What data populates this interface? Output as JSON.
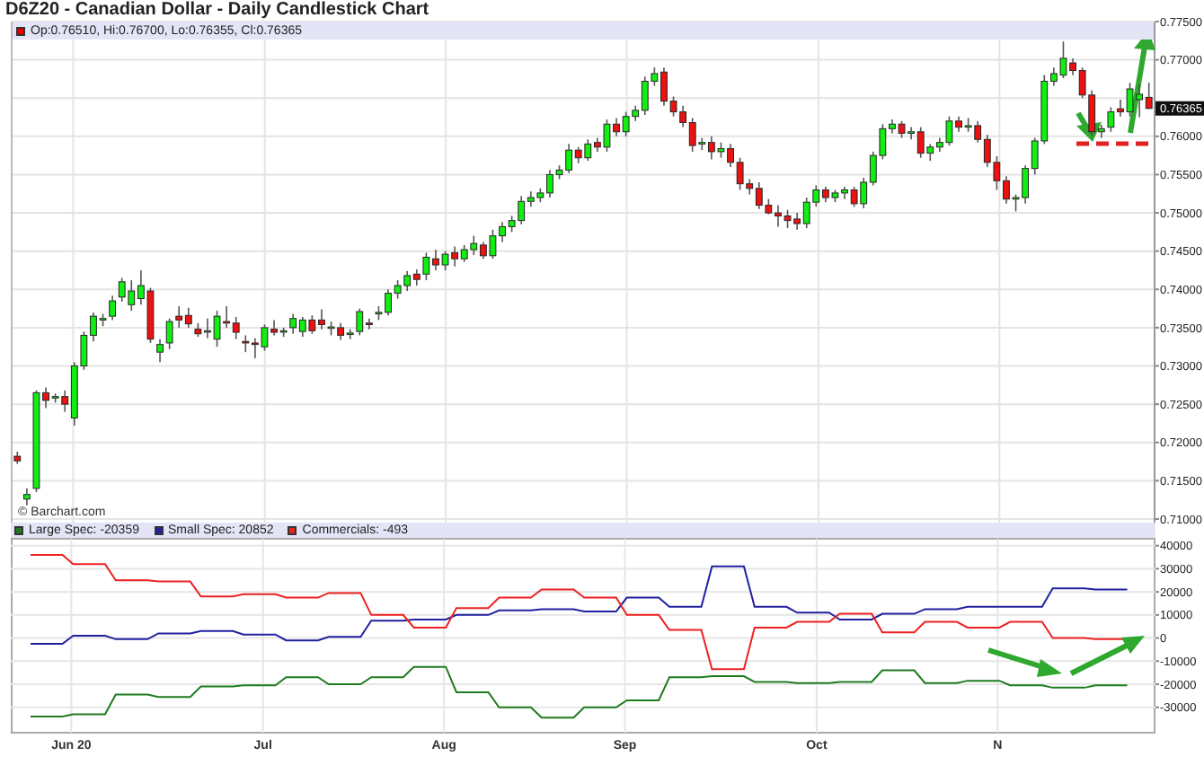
{
  "title": "D6Z20 - Canadian Dollar - Daily Candlestick Chart",
  "price_panel": {
    "legend": "Op:0.76510, Hi:0.76700, Lo:0.76355, Cl:0.76365",
    "last_price": "0.76365",
    "credit": "© Barchart.com",
    "chart_data": {
      "type": "candlestick",
      "ylim": [
        0.71,
        0.775
      ],
      "grid": true,
      "yticks": [
        {
          "value": 0.775,
          "label": "0.77500"
        },
        {
          "value": 0.77,
          "label": "0.77000"
        },
        {
          "value": 0.76,
          "label": "0.76000"
        },
        {
          "value": 0.755,
          "label": "0.75500"
        },
        {
          "value": 0.75,
          "label": "0.75000"
        },
        {
          "value": 0.745,
          "label": "0.74500"
        },
        {
          "value": 0.74,
          "label": "0.74000"
        },
        {
          "value": 0.735,
          "label": "0.73500"
        },
        {
          "value": 0.73,
          "label": "0.73000"
        },
        {
          "value": 0.725,
          "label": "0.72500"
        },
        {
          "value": 0.72,
          "label": "0.72000"
        },
        {
          "value": 0.715,
          "label": "0.71500"
        },
        {
          "value": 0.71,
          "label": "0.71000"
        }
      ],
      "categories": [
        null,
        null,
        null,
        null,
        null,
        null,
        null,
        null,
        null,
        null,
        null,
        null,
        null,
        null,
        null,
        null,
        null,
        null,
        null,
        null,
        null,
        null,
        null,
        null,
        null,
        null,
        null,
        null,
        null,
        null,
        null,
        null,
        null,
        null,
        null,
        null,
        null,
        null,
        null,
        null,
        null,
        null,
        null,
        null,
        null,
        null,
        null,
        null,
        null,
        null,
        null,
        null,
        null,
        null,
        null,
        null,
        null,
        null,
        null,
        null,
        null,
        null,
        null,
        null,
        null,
        null,
        null,
        null,
        null,
        null,
        null,
        null,
        null,
        null,
        null,
        null,
        null,
        null,
        null,
        null,
        null,
        null,
        null,
        null,
        null,
        null,
        null,
        null,
        null,
        null,
        null,
        null,
        null,
        null,
        null,
        null,
        null,
        null,
        null,
        null,
        null,
        null,
        null,
        null,
        null,
        null,
        null,
        null,
        null,
        null,
        null,
        null,
        null,
        null,
        null,
        null,
        null,
        null,
        null,
        null
      ],
      "ohlc": [
        [
          0.7182,
          0.7188,
          0.7172,
          0.7176
        ],
        [
          0.7126,
          0.714,
          0.7118,
          0.7132
        ],
        [
          0.714,
          0.7268,
          0.7135,
          0.7265
        ],
        [
          0.7265,
          0.7272,
          0.7245,
          0.7255
        ],
        [
          0.7258,
          0.7264,
          0.7252,
          0.726
        ],
        [
          0.726,
          0.7268,
          0.724,
          0.725
        ],
        [
          0.7232,
          0.7305,
          0.7222,
          0.73
        ],
        [
          0.73,
          0.7345,
          0.7295,
          0.734
        ],
        [
          0.734,
          0.737,
          0.7332,
          0.7365
        ],
        [
          0.736,
          0.7368,
          0.7352,
          0.7362
        ],
        [
          0.7365,
          0.7392,
          0.736,
          0.7385
        ],
        [
          0.739,
          0.7415,
          0.7384,
          0.741
        ],
        [
          0.738,
          0.7412,
          0.7372,
          0.7398
        ],
        [
          0.7388,
          0.7425,
          0.738,
          0.7405
        ],
        [
          0.7398,
          0.7402,
          0.733,
          0.7335
        ],
        [
          0.7318,
          0.7335,
          0.7305,
          0.7328
        ],
        [
          0.733,
          0.7362,
          0.7322,
          0.7358
        ],
        [
          0.7365,
          0.7378,
          0.735,
          0.736
        ],
        [
          0.7366,
          0.7376,
          0.735,
          0.7355
        ],
        [
          0.7348,
          0.7356,
          0.7338,
          0.7342
        ],
        [
          0.7346,
          0.7362,
          0.7336,
          0.7346
        ],
        [
          0.7335,
          0.7372,
          0.7325,
          0.7365
        ],
        [
          0.7358,
          0.7378,
          0.735,
          0.7356
        ],
        [
          0.7356,
          0.7364,
          0.7335,
          0.7344
        ],
        [
          0.7332,
          0.734,
          0.7318,
          0.733
        ],
        [
          0.733,
          0.7336,
          0.731,
          0.7328
        ],
        [
          0.7325,
          0.7354,
          0.732,
          0.735
        ],
        [
          0.7348,
          0.736,
          0.734,
          0.7344
        ],
        [
          0.7345,
          0.735,
          0.7338,
          0.7346
        ],
        [
          0.735,
          0.7368,
          0.7342,
          0.7362
        ],
        [
          0.7345,
          0.7364,
          0.7338,
          0.736
        ],
        [
          0.736,
          0.7366,
          0.7342,
          0.7346
        ],
        [
          0.736,
          0.7374,
          0.7348,
          0.7354
        ],
        [
          0.735,
          0.7358,
          0.734,
          0.7351
        ],
        [
          0.735,
          0.7356,
          0.7334,
          0.734
        ],
        [
          0.7342,
          0.7348,
          0.7335,
          0.7343
        ],
        [
          0.7345,
          0.7375,
          0.734,
          0.7371
        ],
        [
          0.7356,
          0.7362,
          0.7348,
          0.7354
        ],
        [
          0.7368,
          0.7378,
          0.736,
          0.737
        ],
        [
          0.737,
          0.74,
          0.7366,
          0.7395
        ],
        [
          0.7395,
          0.7412,
          0.7388,
          0.7405
        ],
        [
          0.7405,
          0.7424,
          0.7398,
          0.7418
        ],
        [
          0.742,
          0.7426,
          0.7405,
          0.7413
        ],
        [
          0.742,
          0.7448,
          0.7412,
          0.7442
        ],
        [
          0.744,
          0.7452,
          0.7425,
          0.7432
        ],
        [
          0.7432,
          0.745,
          0.7425,
          0.7446
        ],
        [
          0.7448,
          0.7456,
          0.743,
          0.744
        ],
        [
          0.744,
          0.7458,
          0.7436,
          0.7452
        ],
        [
          0.7452,
          0.747,
          0.7445,
          0.746
        ],
        [
          0.7458,
          0.7462,
          0.744,
          0.7444
        ],
        [
          0.7444,
          0.7478,
          0.744,
          0.747
        ],
        [
          0.747,
          0.7488,
          0.7462,
          0.7482
        ],
        [
          0.7482,
          0.7496,
          0.7475,
          0.749
        ],
        [
          0.749,
          0.7522,
          0.7485,
          0.7515
        ],
        [
          0.7515,
          0.7528,
          0.7508,
          0.752
        ],
        [
          0.752,
          0.7532,
          0.7514,
          0.7526
        ],
        [
          0.7526,
          0.7556,
          0.752,
          0.755
        ],
        [
          0.755,
          0.7562,
          0.7544,
          0.7556
        ],
        [
          0.7556,
          0.759,
          0.7552,
          0.7582
        ],
        [
          0.7582,
          0.7586,
          0.7565,
          0.7572
        ],
        [
          0.7572,
          0.7596,
          0.7568,
          0.759
        ],
        [
          0.7592,
          0.7598,
          0.758,
          0.7586
        ],
        [
          0.7586,
          0.7622,
          0.758,
          0.7616
        ],
        [
          0.7616,
          0.7624,
          0.76,
          0.7606
        ],
        [
          0.7606,
          0.7632,
          0.76,
          0.7626
        ],
        [
          0.7626,
          0.764,
          0.762,
          0.7634
        ],
        [
          0.7634,
          0.7678,
          0.7628,
          0.7672
        ],
        [
          0.7672,
          0.769,
          0.7666,
          0.7682
        ],
        [
          0.7684,
          0.769,
          0.764,
          0.7646
        ],
        [
          0.7646,
          0.7652,
          0.7626,
          0.7632
        ],
        [
          0.7632,
          0.764,
          0.7612,
          0.7618
        ],
        [
          0.7618,
          0.7624,
          0.758,
          0.7588
        ],
        [
          0.759,
          0.7598,
          0.7582,
          0.7592
        ],
        [
          0.7592,
          0.76,
          0.757,
          0.758
        ],
        [
          0.758,
          0.7592,
          0.7572,
          0.7584
        ],
        [
          0.7584,
          0.759,
          0.756,
          0.7566
        ],
        [
          0.7566,
          0.7572,
          0.753,
          0.7538
        ],
        [
          0.7538,
          0.7544,
          0.7524,
          0.7532
        ],
        [
          0.7532,
          0.754,
          0.7505,
          0.751
        ],
        [
          0.751,
          0.7518,
          0.7498,
          0.75
        ],
        [
          0.75,
          0.751,
          0.7482,
          0.7496
        ],
        [
          0.7496,
          0.7504,
          0.748,
          0.749
        ],
        [
          0.7492,
          0.75,
          0.7478,
          0.7486
        ],
        [
          0.7486,
          0.752,
          0.748,
          0.7514
        ],
        [
          0.7514,
          0.7536,
          0.7508,
          0.753
        ],
        [
          0.753,
          0.7534,
          0.7514,
          0.752
        ],
        [
          0.752,
          0.753,
          0.7514,
          0.7526
        ],
        [
          0.7526,
          0.7534,
          0.7518,
          0.753
        ],
        [
          0.753,
          0.7534,
          0.7508,
          0.7512
        ],
        [
          0.7512,
          0.7546,
          0.7506,
          0.754
        ],
        [
          0.754,
          0.758,
          0.7536,
          0.7575
        ],
        [
          0.7575,
          0.7616,
          0.757,
          0.761
        ],
        [
          0.761,
          0.7622,
          0.7604,
          0.7616
        ],
        [
          0.7616,
          0.762,
          0.7598,
          0.7604
        ],
        [
          0.7604,
          0.7612,
          0.7596,
          0.7606
        ],
        [
          0.7606,
          0.7612,
          0.7572,
          0.7578
        ],
        [
          0.7578,
          0.759,
          0.7568,
          0.7586
        ],
        [
          0.7586,
          0.7598,
          0.758,
          0.7592
        ],
        [
          0.7592,
          0.7626,
          0.7588,
          0.762
        ],
        [
          0.762,
          0.7626,
          0.7606,
          0.7612
        ],
        [
          0.7612,
          0.7624,
          0.7606,
          0.7614
        ],
        [
          0.7614,
          0.762,
          0.7592,
          0.7596
        ],
        [
          0.7596,
          0.7602,
          0.756,
          0.7566
        ],
        [
          0.7566,
          0.7574,
          0.753,
          0.7542
        ],
        [
          0.7542,
          0.7548,
          0.7512,
          0.7518
        ],
        [
          0.7518,
          0.7524,
          0.7502,
          0.752
        ],
        [
          0.752,
          0.7562,
          0.7512,
          0.7558
        ],
        [
          0.7558,
          0.7598,
          0.755,
          0.7594
        ],
        [
          0.7594,
          0.768,
          0.759,
          0.7672
        ],
        [
          0.7672,
          0.769,
          0.7666,
          0.7682
        ],
        [
          0.768,
          0.7724,
          0.7676,
          0.7702
        ],
        [
          0.7696,
          0.7702,
          0.768,
          0.7686
        ],
        [
          0.7686,
          0.769,
          0.765,
          0.7654
        ],
        [
          0.7654,
          0.766,
          0.76,
          0.7606
        ],
        [
          0.7606,
          0.7615,
          0.7598,
          0.761
        ],
        [
          0.7612,
          0.7638,
          0.7606,
          0.7632
        ],
        [
          0.7636,
          0.7648,
          0.7626,
          0.7632
        ],
        [
          0.7632,
          0.767,
          0.7626,
          0.7662
        ],
        [
          0.7648,
          0.7668,
          0.7625,
          0.7655
        ],
        [
          0.7651,
          0.767,
          0.76355,
          0.76365
        ]
      ]
    }
  },
  "cot_panel": {
    "legend": [
      "Large Spec: -20359",
      "Small Spec: 20852",
      "Commercials: -493"
    ],
    "chart_data": {
      "type": "line",
      "grid": true,
      "categories": [
        null,
        null,
        null,
        null,
        "Jun 20",
        null,
        null,
        null,
        null,
        null,
        null,
        null,
        null,
        null,
        null,
        null,
        null,
        null,
        null,
        null,
        null,
        null,
        "Jul",
        null,
        null,
        null,
        null,
        null,
        null,
        null,
        null,
        null,
        null,
        null,
        null,
        null,
        null,
        null,
        null,
        "Aug",
        null,
        null,
        null,
        null,
        null,
        null,
        null,
        null,
        null,
        null,
        null,
        null,
        null,
        null,
        null,
        null,
        "Sep",
        null,
        null,
        null,
        null,
        null,
        null,
        null,
        null,
        null,
        null,
        null,
        null,
        null,
        null,
        null,
        null,
        null,
        "Oct",
        null,
        null,
        null,
        null,
        null,
        null,
        null,
        null,
        null,
        null,
        null,
        null,
        null,
        null,
        null,
        null,
        "N",
        null,
        null,
        null,
        null,
        null,
        null,
        null,
        null,
        null,
        null,
        null,
        null
      ],
      "series": [
        {
          "color": "#1e7b1e",
          "values": [
            -34000,
            -34000,
            -34000,
            -34000,
            -33000,
            -33000,
            -33000,
            -33000,
            -24500,
            -24500,
            -24500,
            -24500,
            -25500,
            -25500,
            -25500,
            -25500,
            -21000,
            -21000,
            -21000,
            -21000,
            -20500,
            -20500,
            -20500,
            -20500,
            -17000,
            -17000,
            -17000,
            -17000,
            -20000,
            -20000,
            -20000,
            -20000,
            -17000,
            -17000,
            -17000,
            -17000,
            -12500,
            -12500,
            -12500,
            -12500,
            -23500,
            -23500,
            -23500,
            -23500,
            -30000,
            -30000,
            -30000,
            -30000,
            -34500,
            -34500,
            -34500,
            -34500,
            -30000,
            -30000,
            -30000,
            -30000,
            -27000,
            -27000,
            -27000,
            -27000,
            -17000,
            -17000,
            -17000,
            -17000,
            -16500,
            -16500,
            -16500,
            -16500,
            -19000,
            -19000,
            -19000,
            -19000,
            -19500,
            -19500,
            -19500,
            -19500,
            -19000,
            -19000,
            -19000,
            -19000,
            -14000,
            -14000,
            -14000,
            -14000,
            -19500,
            -19500,
            -19500,
            -19500,
            -18500,
            -18500,
            -18500,
            -18500,
            -20500,
            -20500,
            -20500,
            -20500,
            -21500,
            -21500,
            -21500,
            -21500,
            -20500,
            -20500,
            -20500,
            -20500
          ]
        },
        {
          "color": "#2020a0",
          "values": [
            -2500,
            -2500,
            -2500,
            -2500,
            1000,
            1000,
            1000,
            1000,
            -500,
            -500,
            -500,
            -500,
            2000,
            2000,
            2000,
            2000,
            3000,
            3000,
            3000,
            3000,
            1500,
            1500,
            1500,
            1500,
            -1000,
            -1000,
            -1000,
            -1000,
            500,
            500,
            500,
            500,
            7500,
            7500,
            7500,
            7500,
            8000,
            8000,
            8000,
            8000,
            10000,
            10000,
            10000,
            10000,
            12000,
            12000,
            12000,
            12000,
            12500,
            12500,
            12500,
            12500,
            11500,
            11500,
            11500,
            11500,
            17500,
            17500,
            17500,
            17500,
            13500,
            13500,
            13500,
            13500,
            31000,
            31000,
            31000,
            31000,
            13500,
            13500,
            13500,
            13500,
            11000,
            11000,
            11000,
            11000,
            8000,
            8000,
            8000,
            8000,
            10500,
            10500,
            10500,
            10500,
            12500,
            12500,
            12500,
            12500,
            13500,
            13500,
            13500,
            13500,
            13500,
            13500,
            13500,
            13500,
            21500,
            21500,
            21500,
            21500,
            21000,
            21000,
            21000,
            21000
          ]
        },
        {
          "color": "#ee2020",
          "values": [
            36000,
            36000,
            36000,
            36000,
            32000,
            32000,
            32000,
            32000,
            25000,
            25000,
            25000,
            25000,
            24500,
            24500,
            24500,
            24500,
            18000,
            18000,
            18000,
            18000,
            19000,
            19000,
            19000,
            19000,
            17500,
            17500,
            17500,
            17500,
            19500,
            19500,
            19500,
            19500,
            10000,
            10000,
            10000,
            10000,
            4500,
            4500,
            4500,
            4500,
            13000,
            13000,
            13000,
            13000,
            17500,
            17500,
            17500,
            17500,
            21000,
            21000,
            21000,
            21000,
            17500,
            17500,
            17500,
            17500,
            10000,
            10000,
            10000,
            10000,
            3500,
            3500,
            3500,
            3500,
            -13500,
            -13500,
            -13500,
            -13500,
            4500,
            4500,
            4500,
            4500,
            7000,
            7000,
            7000,
            7000,
            10500,
            10500,
            10500,
            10500,
            2500,
            2500,
            2500,
            2500,
            7000,
            7000,
            7000,
            7000,
            4500,
            4500,
            4500,
            4500,
            7000,
            7000,
            7000,
            7000,
            0,
            0,
            0,
            0,
            -500,
            -500,
            -500,
            -500
          ]
        }
      ],
      "ylim": [
        -41000,
        43000
      ],
      "yticks": [
        {
          "value": 40000,
          "label": "40000"
        },
        {
          "value": 30000,
          "label": "30000"
        },
        {
          "value": 20000,
          "label": "20000"
        },
        {
          "value": 10000,
          "label": "10000"
        },
        {
          "value": 0,
          "label": "0"
        },
        {
          "value": -10000,
          "label": "-10000"
        },
        {
          "value": -20000,
          "label": "-20000"
        },
        {
          "value": -30000,
          "label": "-30000"
        }
      ]
    }
  }
}
